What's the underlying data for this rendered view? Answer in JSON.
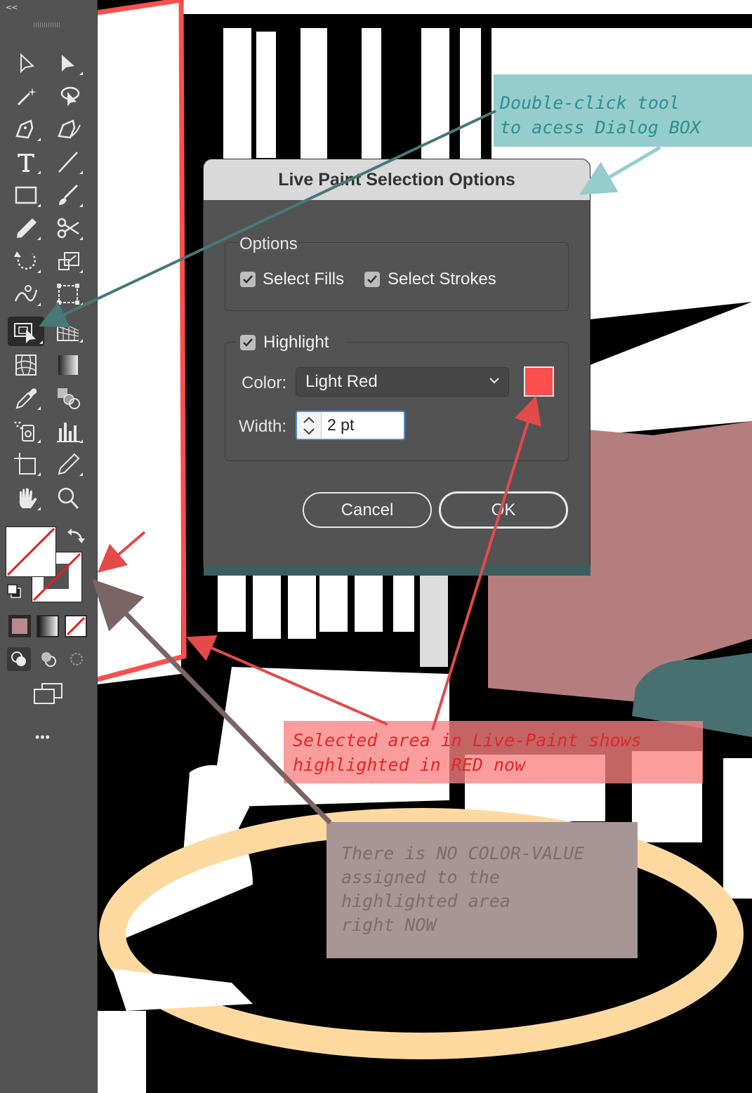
{
  "toolbar": {
    "collapse_label": "<<",
    "more_label": "•••",
    "tools": [
      {
        "name": "selection-tool-icon"
      },
      {
        "name": "direct-selection-tool-icon"
      },
      {
        "name": "magic-wand-tool-icon"
      },
      {
        "name": "lasso-tool-icon"
      },
      {
        "name": "pen-tool-icon"
      },
      {
        "name": "curvature-tool-icon"
      },
      {
        "name": "type-tool-icon"
      },
      {
        "name": "line-segment-tool-icon"
      },
      {
        "name": "rectangle-tool-icon"
      },
      {
        "name": "paintbrush-tool-icon"
      },
      {
        "name": "pencil-tool-icon"
      },
      {
        "name": "scissors-tool-icon"
      },
      {
        "name": "rotate-tool-icon"
      },
      {
        "name": "scale-tool-icon"
      },
      {
        "name": "warp-tool-icon"
      },
      {
        "name": "free-transform-tool-icon"
      },
      {
        "name": "live-paint-selection-tool-icon",
        "active": true
      },
      {
        "name": "perspective-grid-tool-icon"
      },
      {
        "name": "mesh-tool-icon"
      },
      {
        "name": "gradient-tool-icon"
      },
      {
        "name": "eyedropper-tool-icon"
      },
      {
        "name": "blend-tool-icon"
      },
      {
        "name": "symbol-sprayer-tool-icon"
      },
      {
        "name": "column-graph-tool-icon"
      },
      {
        "name": "artboard-tool-icon"
      },
      {
        "name": "slice-tool-icon"
      },
      {
        "name": "hand-tool-icon"
      },
      {
        "name": "zoom-tool-icon"
      }
    ],
    "fill_color": "none",
    "stroke_color": "none",
    "color_mode_swatch": "#b88a8a"
  },
  "dialog": {
    "title": "Live Paint Selection Options",
    "options_group_label": "Options",
    "select_fills_label": "Select Fills",
    "select_fills_checked": true,
    "select_strokes_label": "Select Strokes",
    "select_strokes_checked": true,
    "highlight_label": "Highlight",
    "highlight_checked": true,
    "color_label": "Color:",
    "color_value": "Light Red",
    "swatch_color": "#fb4e4e",
    "width_label": "Width:",
    "width_value": "2 pt",
    "cancel_label": "Cancel",
    "ok_label": "OK"
  },
  "annotations": {
    "tool_hint": "Double-click tool\nto acess Dialog BOX",
    "selected_area": "Selected area in Live-Paint shows\nhighlighted in RED now",
    "no_color": "There is NO COLOR-VALUE\nassigned to the\nhighlighted area\nright NOW"
  },
  "colors": {
    "highlight_red": "#fb4e4e",
    "rose": "#b57d7d",
    "teal": "#487070",
    "tan": "#fdd9a0",
    "callout_teal_bg": "#95cccd",
    "callout_brown_bg": "#a89595"
  }
}
